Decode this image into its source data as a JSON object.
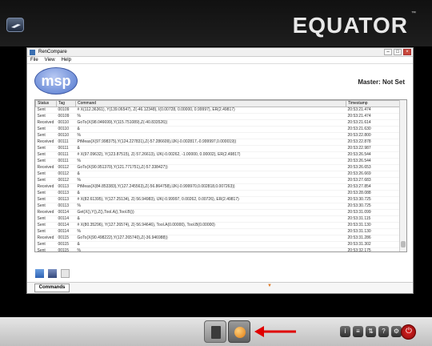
{
  "brand": {
    "name": "EQUATOR",
    "tm": "™"
  },
  "window": {
    "title": "RenCompare",
    "menu": [
      "File",
      "View",
      "Help"
    ],
    "logo_text": "msp",
    "master_status": "Master: Not Set"
  },
  "table": {
    "headers": [
      "Status",
      "Tag",
      "Command",
      "Timestamp"
    ],
    "rows": [
      [
        "Sent",
        "00109",
        "# X(112.36361), Y(139.06547), Z(-46.12348), I(0.00728, 0.00000, 0.99997), ER(2.49817)",
        "20:53:21.474"
      ],
      [
        "Sent",
        "00109",
        "%",
        "20:53:21.474"
      ],
      [
        "Received",
        "00110",
        "GoTo(X(98.046699),Y(115.751089),Z(-40.833526))",
        "20:53:21.614"
      ],
      [
        "Sent",
        "00110",
        "&",
        "20:53:21.630"
      ],
      [
        "Sent",
        "00110",
        "%",
        "20:53:22.800"
      ],
      [
        "Received",
        "00111",
        "PtMeas(X(97.998375),Y(124.227831),Z(-57.286609),IJK(-0.002817,-0.999997,0.000019))",
        "20:53:22.878"
      ],
      [
        "Sent",
        "00111",
        "&",
        "20:53:22.987"
      ],
      [
        "Sent",
        "00111",
        "# X(97.09632), Y(123.87515), Z(-57.26613), IJK(-0.00262, -1.00000, 0.00002), ER(2.49817)",
        "20:53:26.544"
      ],
      [
        "Sent",
        "00111",
        "%",
        "20:53:26.544"
      ],
      [
        "Received",
        "00112",
        "GoTo(X(90.951370),Y(121.771751),Z(-57.338427))",
        "20:53:26.653"
      ],
      [
        "Sent",
        "00112",
        "&",
        "20:53:26.669"
      ],
      [
        "Sent",
        "00112",
        "%",
        "20:53:27.683"
      ],
      [
        "Received",
        "00113",
        "PtMeas(X(84.853383),Y(127.245563),Z(-56.864758),IJK(-0.999970,0.002818,0.007263))",
        "20:53:27.854"
      ],
      [
        "Sent",
        "00113",
        "&",
        "20:53:28.088"
      ],
      [
        "Sent",
        "00113",
        "# X(82.61395), Y(127.25134), Z(-56.94983), IJK(-0.99997, 0.00262, 0.00726), ER(2.49817)",
        "20:53:30.725"
      ],
      [
        "Sent",
        "00113",
        "%",
        "20:53:30.725"
      ],
      [
        "Received",
        "00114",
        "Get(X(),Y(),Z(),Tool.A(),Tool.B())",
        "20:53:31.099"
      ],
      [
        "Sent",
        "00114",
        "&",
        "20:53:31.115"
      ],
      [
        "Sent",
        "00114",
        "# X(80.35296), Y(127.26574), Z(-56.94646), Tool.A(0.00000), Tool.B(0.00000)",
        "20:53:31.130"
      ],
      [
        "Sent",
        "00114",
        "%",
        "20:53:31.130"
      ],
      [
        "Received",
        "00115",
        "GoTo(X(90.498222),Y(127.265740),Z(-36.946988))",
        "20:53:31.286"
      ],
      [
        "Sent",
        "00115",
        "&",
        "20:53:31.302"
      ],
      [
        "Sent",
        "00115",
        "%",
        "20:53:32.175"
      ],
      [
        "Received",
        "00116",
        "GoTo(X(0.000000),Y(110.000000),Z(-40.000000))",
        "20:53:32.394"
      ],
      [
        "Sent",
        "00116",
        "&",
        "20:53:32.643"
      ],
      [
        "Sent",
        "00116",
        "%",
        "20:53:34.281"
      ],
      [
        "*M*",
        "",
        "Server has disconnected",
        "20:53:38.603"
      ],
      [
        "*M*",
        "",
        "Client has disconnected",
        "20:53:38.603"
      ]
    ]
  },
  "tabs": {
    "commands": "Commands"
  },
  "tools": [
    "i",
    "≡",
    "⇅",
    "?",
    "⚙"
  ]
}
